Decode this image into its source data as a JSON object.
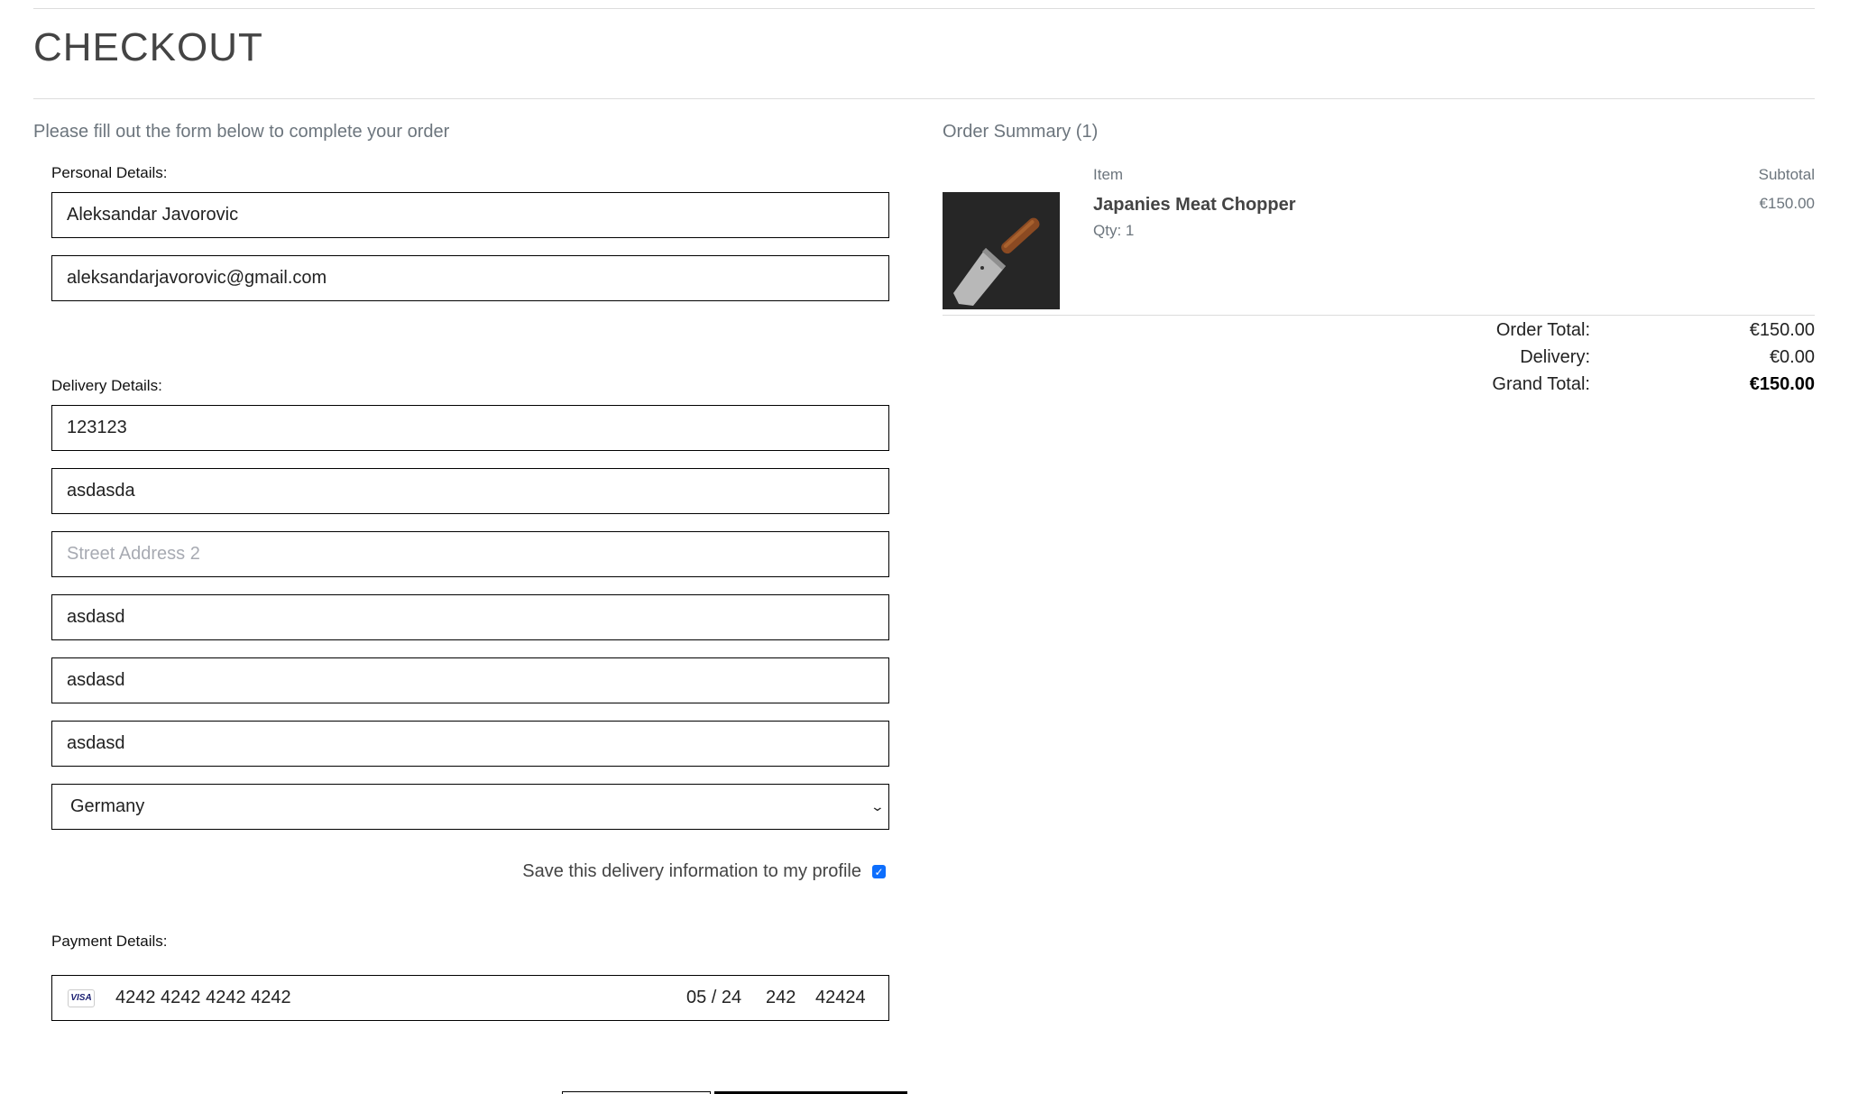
{
  "page": {
    "title": "CHECKOUT",
    "intro": "Please fill out the form below to complete your order"
  },
  "form": {
    "personal_label": "Personal Details:",
    "full_name": "Aleksandar Javorovic",
    "email": "aleksandarjavorovic@gmail.com",
    "delivery_label": "Delivery Details:",
    "phone": "123123",
    "street1": "asdasda",
    "street2_placeholder": "Street Address 2",
    "town": "asdasd",
    "county": "asdasd",
    "postcode": "asdasd",
    "country": "Germany",
    "save_info_label": "Save this delivery information to my profile",
    "save_info_checked": true,
    "payment_label": "Payment Details:",
    "card": {
      "brand": "VISA",
      "number": "4242 4242 4242 4242",
      "expiry": "05 / 24",
      "cvc": "242",
      "zip": "42424"
    }
  },
  "summary": {
    "title": "Order Summary (1)",
    "col_item": "Item",
    "col_subtotal": "Subtotal",
    "product": {
      "name": "Japanies Meat Chopper",
      "qty": "Qty: 1",
      "price": "€150.00"
    },
    "order_total_label": "Order Total:",
    "order_total": "€150.00",
    "delivery_label": "Delivery:",
    "delivery": "€0.00",
    "grand_total_label": "Grand Total:",
    "grand_total": "€150.00"
  },
  "colors": {
    "accent": "#0d6efd",
    "button_dark": "#000000",
    "muted": "#6c757d"
  }
}
